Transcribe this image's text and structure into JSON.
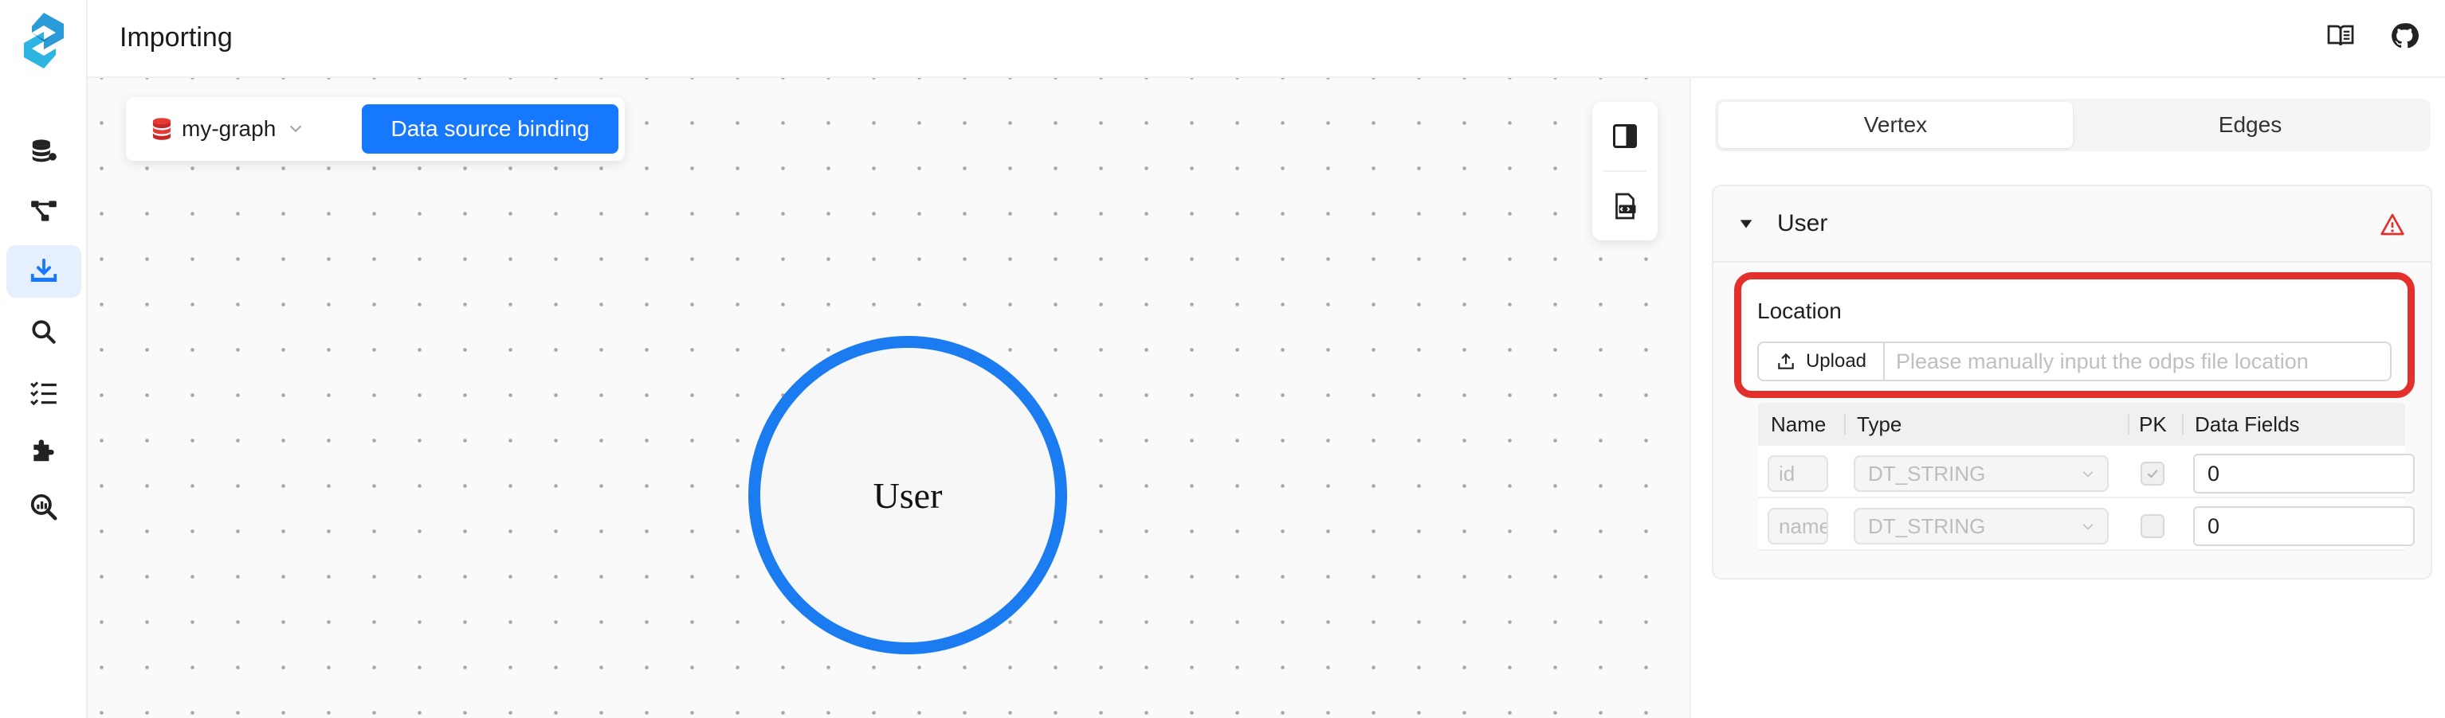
{
  "app": {
    "logo_icon": "graphscope-logo-icon",
    "accent": "#1677ff"
  },
  "header": {
    "title": "Importing"
  },
  "sidebar": {
    "items": [
      {
        "name": "graph-database-icon"
      },
      {
        "name": "modeling-icon"
      },
      {
        "name": "importing-icon",
        "active": true
      },
      {
        "name": "query-icon"
      },
      {
        "name": "jobs-icon"
      },
      {
        "name": "extensions-icon"
      },
      {
        "name": "algorithm-icon"
      }
    ]
  },
  "toolbar": {
    "graph_name": "my-graph",
    "bind_label": "Data source binding"
  },
  "canvas": {
    "vertex_label": "User"
  },
  "panel": {
    "tabs": [
      {
        "label": "Vertex",
        "active": true
      },
      {
        "label": "Edges",
        "active": false
      }
    ],
    "card": {
      "title": "User",
      "location_label": "Location",
      "upload_label": "Upload",
      "location_placeholder": "Please manually input the odps file location",
      "columns": [
        "Name",
        "Type",
        "PK",
        "Data Fields"
      ],
      "rows": [
        {
          "name": "id",
          "type": "DT_STRING",
          "pk": true,
          "field": "0"
        },
        {
          "name": "name",
          "type": "DT_STRING",
          "pk": false,
          "field": "0"
        }
      ]
    }
  },
  "status_colors": {
    "highlight": "#e3302c",
    "warning": "#e3302c"
  }
}
